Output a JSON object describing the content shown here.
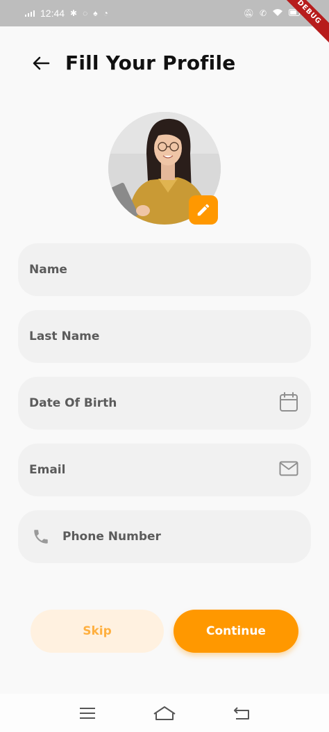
{
  "status_bar": {
    "time": "12:44",
    "left_icons": [
      "slack-icon",
      "whatsapp-icon",
      "snapchat-icon",
      "navigation-icon"
    ],
    "right_icons": [
      "notifications-off-icon",
      "call-icon",
      "wifi-icon",
      "battery-icon"
    ],
    "debug_banner": "DEBUG"
  },
  "header": {
    "back_icon": "arrow-left-icon",
    "title": "Fill Your Profile"
  },
  "avatar": {
    "edit_icon": "pencil-icon",
    "accent_color": "#ff9800"
  },
  "form": {
    "name": {
      "placeholder": "Name"
    },
    "last_name": {
      "placeholder": "Last Name"
    },
    "date_of_birth": {
      "placeholder": "Date Of Birth",
      "icon": "calendar-icon"
    },
    "email": {
      "placeholder": "Email",
      "icon": "mail-icon"
    },
    "phone": {
      "placeholder": "Phone Number",
      "icon": "phone-icon"
    }
  },
  "actions": {
    "skip_label": "Skip",
    "continue_label": "Continue"
  },
  "nav_bar": {
    "icons": [
      "menu-icon",
      "home-icon",
      "back-icon"
    ]
  },
  "colors": {
    "primary": "#ff9800",
    "skip_bg": "#fff1e0",
    "field_bg": "#f1f1f1"
  }
}
